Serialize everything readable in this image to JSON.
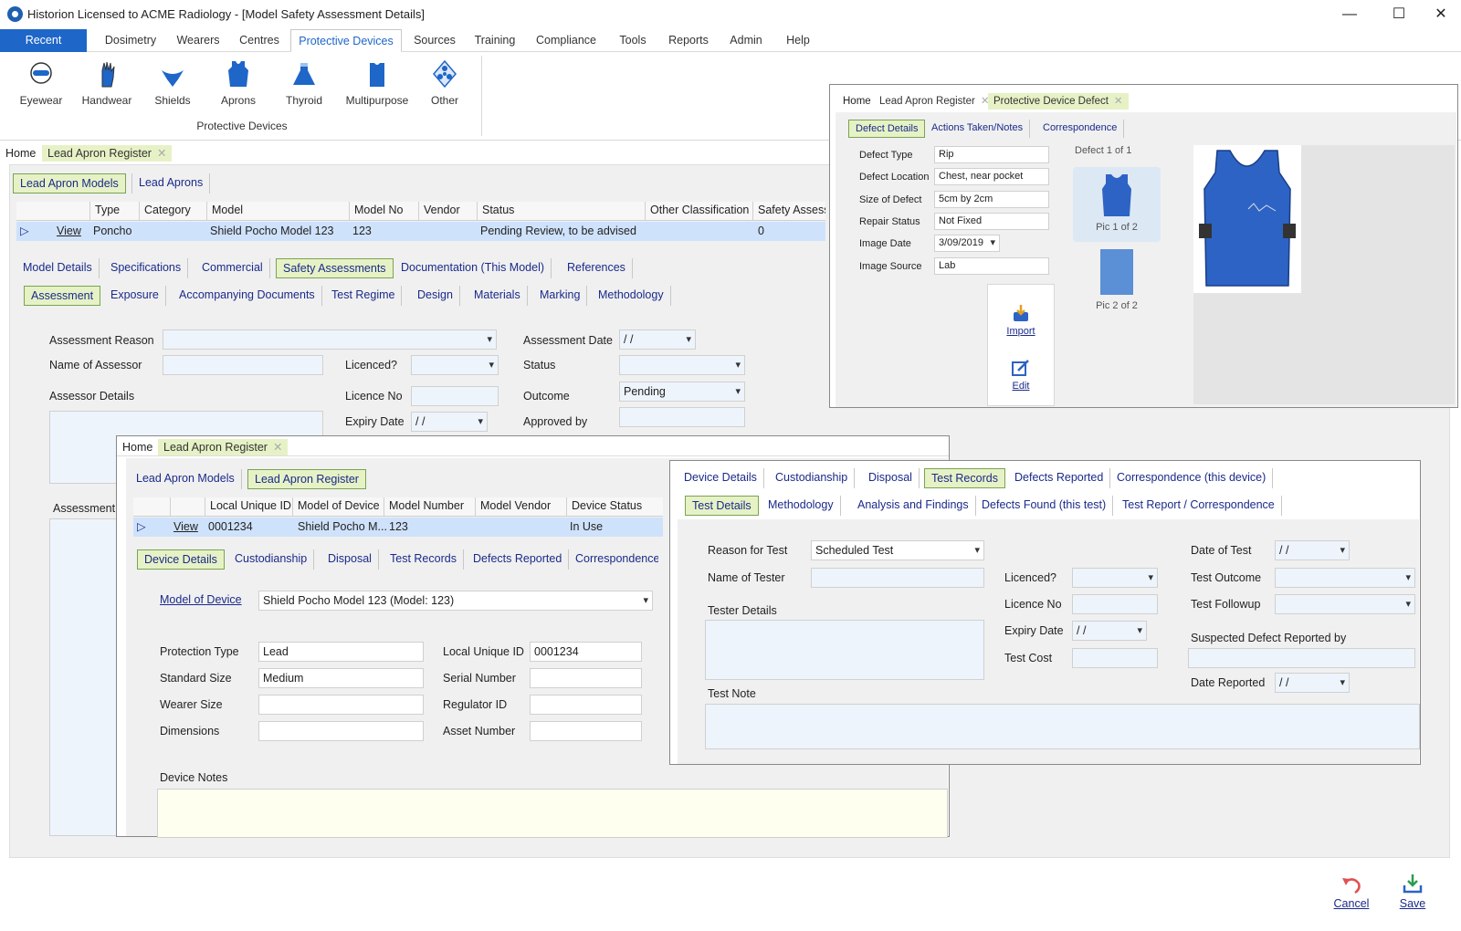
{
  "window": {
    "title": "Historion Licensed to ACME Radiology - [Model Safety Assessment Details]",
    "minimize": "—",
    "maximize": "☐",
    "close": "✕"
  },
  "menu": [
    "Recent",
    "Dosimetry",
    "Wearers",
    "Centres",
    "Protective Devices",
    "Sources",
    "Training",
    "Compliance",
    "Tools",
    "Reports",
    "Admin",
    "Help"
  ],
  "ribbon": {
    "buttons": [
      "Eyewear",
      "Handwear",
      "Shields",
      "Aprons",
      "Thyroid",
      "Multipurpose",
      "Other"
    ],
    "group": "Protective Devices"
  },
  "main": {
    "tabs": {
      "home": "Home",
      "doc": "Lead Apron Register"
    },
    "subtabs": [
      "Lead Apron Models",
      "Lead Aprons"
    ],
    "grid": {
      "headers": [
        "Type",
        "Category",
        "Model",
        "Model No",
        "Vendor",
        "Status",
        "Other Classification",
        "Safety Assessi"
      ],
      "row": {
        "link": "View",
        "type": "Poncho",
        "category": "",
        "model": "Shield Pocho Model 123",
        "model_no": "123",
        "vendor": "",
        "status": "Pending Review, to be advised",
        "other": "",
        "safety": "0"
      }
    },
    "detail_tabs": [
      "Model Details",
      "Specifications",
      "Commercial",
      "Safety Assessments",
      "Documentation (This Model)",
      "References"
    ],
    "assessment_tabs": [
      "Assessment",
      "Exposure",
      "Accompanying Documents",
      "Test Regime",
      "Design",
      "Materials",
      "Marking",
      "Methodology"
    ],
    "form": {
      "assessment_reason": "Assessment Reason",
      "name_of_assessor": "Name of Assessor",
      "assessor_details": "Assessor Details",
      "licenced": "Licenced?",
      "licence_no": "Licence No",
      "expiry_date": "Expiry Date",
      "expiry_value": " /  /",
      "assessment_date": "Assessment Date",
      "assessment_date_value": " /  /",
      "status": "Status",
      "outcome": "Outcome",
      "outcome_value": "Pending",
      "approved_by": "Approved by",
      "assessment": "Assessment"
    }
  },
  "defect_window": {
    "tabs": {
      "home": "Home",
      "reg": "Lead Apron Register",
      "doc": "Protective Device Defect"
    },
    "subtabs": [
      "Defect Details",
      "Actions Taken/Notes",
      "Correspondence"
    ],
    "fields": [
      {
        "label": "Defect Type",
        "value": "Rip"
      },
      {
        "label": "Defect Location",
        "value": "Chest, near pocket"
      },
      {
        "label": "Size of Defect",
        "value": "5cm by 2cm"
      },
      {
        "label": "Repair Status",
        "value": "Not Fixed"
      },
      {
        "label": "Image Date",
        "value": "3/09/2019"
      },
      {
        "label": "Image Source",
        "value": "Lab"
      }
    ],
    "counter": "Defect 1 of 1",
    "pics": [
      "Pic 1 of 2",
      "Pic 2 of 2"
    ],
    "import": "Import",
    "edit": "Edit"
  },
  "device_window": {
    "tabs": {
      "home": "Home",
      "doc": "Lead Apron Register"
    },
    "subtabs": [
      "Lead Apron Models",
      "Lead Apron Register"
    ],
    "grid": {
      "headers": [
        "Local Unique ID",
        "Model of Device",
        "Model Number",
        "Model Vendor",
        "Device Status"
      ],
      "row": {
        "link": "View",
        "id": "0001234",
        "model": "Shield Pocho M...",
        "number": "123",
        "vendor": "",
        "status": "In Use"
      }
    },
    "tabs2": [
      "Device Details",
      "Custodianship",
      "Disposal",
      "Test Records",
      "Defects Reported",
      "Correspondence (t"
    ],
    "model_link": "Model of Device",
    "model_value": "Shield Pocho Model 123 (Model: 123)",
    "left": [
      {
        "label": "Protection Type",
        "value": "Lead"
      },
      {
        "label": "Standard Size",
        "value": "Medium"
      },
      {
        "label": "Wearer Size",
        "value": ""
      },
      {
        "label": "Dimensions",
        "value": ""
      }
    ],
    "right": [
      {
        "label": "Local Unique ID",
        "value": "0001234"
      },
      {
        "label": "Serial Number",
        "value": ""
      },
      {
        "label": "Regulator ID",
        "value": ""
      },
      {
        "label": "Asset Number",
        "value": ""
      }
    ],
    "notes": "Device Notes"
  },
  "test_window": {
    "tabs": [
      "Device Details",
      "Custodianship",
      "Disposal",
      "Test Records",
      "Defects Reported",
      "Correspondence (this device)"
    ],
    "subtabs": [
      "Test Details",
      "Methodology",
      "Analysis and Findings",
      "Defects Found (this test)",
      "Test Report / Correspondence"
    ],
    "reason_label": "Reason for Test",
    "reason_value": "Scheduled Test",
    "tester": "Name of Tester",
    "tester_details": "Tester Details",
    "test_note": "Test Note",
    "licenced": "Licenced?",
    "licence_no": "Licence No",
    "expiry": "Expiry Date",
    "expiry_value": " /  /",
    "cost": "Test Cost",
    "date": "Date of Test",
    "date_value": " /  /",
    "outcome": "Test Outcome",
    "followup": "Test Followup",
    "suspected": "Suspected Defect Reported by",
    "reported": "Date Reported",
    "reported_value": " /  /"
  },
  "footer": {
    "cancel": "Cancel",
    "save": "Save"
  },
  "colors": {
    "accent": "#1e66c8",
    "tab_selected": "#e6f2c6",
    "row_selected": "#cfe2fb",
    "link": "#1a2a8a"
  }
}
